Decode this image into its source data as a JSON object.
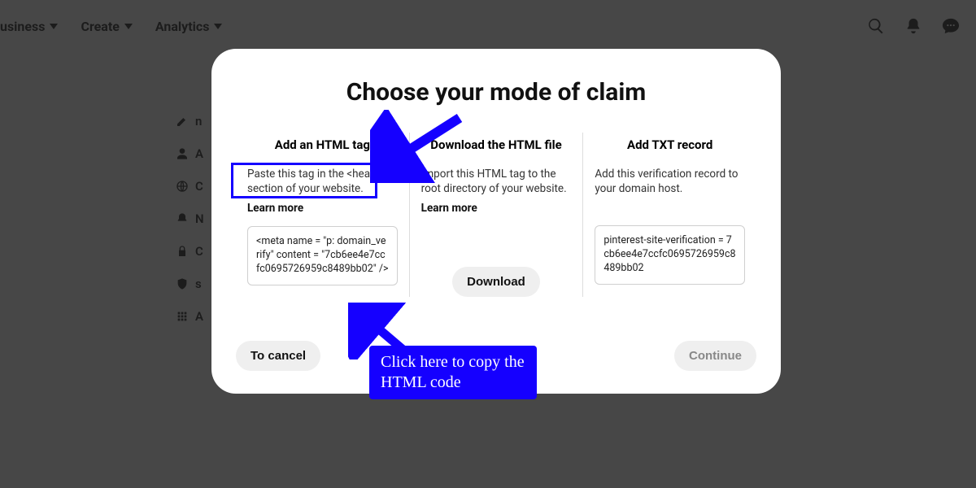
{
  "nav": {
    "items": [
      "usiness",
      "Create",
      "Analytics"
    ]
  },
  "sidebar": {
    "items": [
      "n",
      "A",
      "C",
      "N",
      "C",
      "s",
      "A"
    ]
  },
  "modal": {
    "title": "Choose your mode of claim",
    "col1": {
      "heading": "Add an HTML tag",
      "desc": "Paste this tag in the <head> section of your website.",
      "learn": "Learn more",
      "code": "<meta name = \"p: domain_verify\" content = \"7cb6ee4e7ccfc0695726959c8489bb02\" />"
    },
    "col2": {
      "heading": "Download the HTML file",
      "desc": "Import this HTML tag to the root directory of your website.",
      "learn": "Learn more",
      "button": "Download"
    },
    "col3": {
      "heading": "Add TXT record",
      "desc": "Add this verification record to your domain host.",
      "code": "pinterest-site-verification = 7cb6ee4e7ccfc0695726959c8489bb02"
    },
    "cancel": "To cancel",
    "continue": "Continue"
  },
  "annotation": {
    "callout": "Click here to copy the HTML code"
  }
}
